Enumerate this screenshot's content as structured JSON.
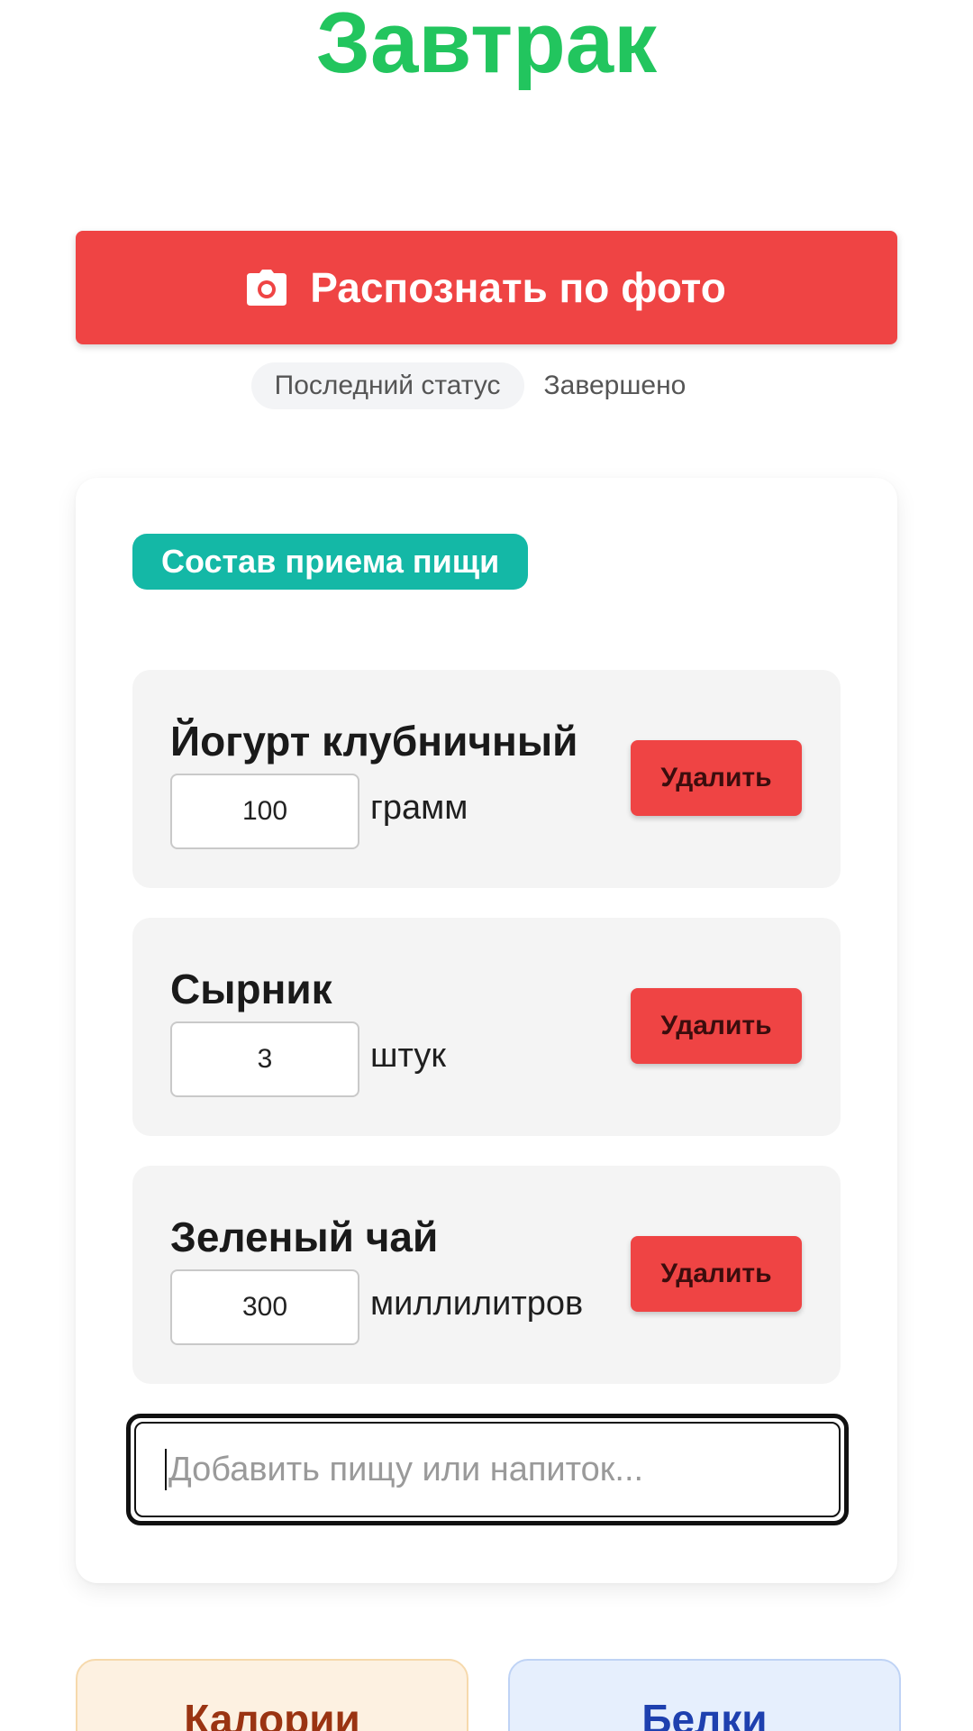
{
  "header": {
    "title": "Завтрак"
  },
  "photo_button": {
    "label": "Распознать по фото",
    "icon": "camera-icon"
  },
  "status": {
    "label": "Последний статус",
    "value": "Завершено"
  },
  "meal": {
    "section_label": "Состав приема пищи",
    "items": [
      {
        "name": "Йогурт клубничный",
        "quantity": "100",
        "unit": "грамм",
        "delete_label": "Удалить"
      },
      {
        "name": "Сырник",
        "quantity": "3",
        "unit": "штук",
        "delete_label": "Удалить"
      },
      {
        "name": "Зеленый чай",
        "quantity": "300",
        "unit": "миллилитров",
        "delete_label": "Удалить"
      }
    ],
    "add_placeholder": "Добавить пищу или напиток..."
  },
  "stats": {
    "calories_label": "Калории",
    "protein_label": "Белки"
  },
  "colors": {
    "title": "#22c55e",
    "primary_red": "#ef4444",
    "teal": "#14b8a6",
    "calories_text": "#9a3412",
    "protein_text": "#1e40af"
  }
}
